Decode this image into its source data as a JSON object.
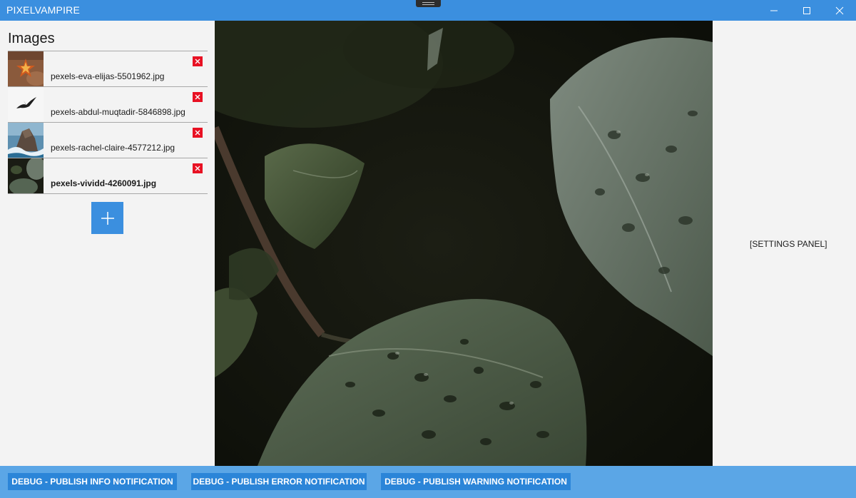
{
  "titlebar": {
    "title": "PIXELVAMPIRE"
  },
  "images_panel": {
    "heading": "Images",
    "items": [
      {
        "file_name": "pexels-eva-elijas-5501962.jpg",
        "selected": false,
        "thumb_icon": "star-ornament-thumbnail"
      },
      {
        "file_name": "pexels-abdul-muqtadir-5846898.jpg",
        "selected": false,
        "thumb_icon": "bird-thumbnail"
      },
      {
        "file_name": "pexels-rachel-claire-4577212.jpg",
        "selected": false,
        "thumb_icon": "rock-sea-thumbnail"
      },
      {
        "file_name": "pexels-vividd-4260091.jpg",
        "selected": true,
        "thumb_icon": "leaves-thumbnail"
      }
    ],
    "remove_icon": "close-icon",
    "add_icon": "plus-icon"
  },
  "settings_panel": {
    "label": "[SETTINGS PANEL]"
  },
  "debug_bar": {
    "info_label": "DEBUG - PUBLISH INFO NOTIFICATION",
    "error_label": "DEBUG - PUBLISH ERROR NOTIFICATION",
    "warning_label": "DEBUG - PUBLISH WARNING NOTIFICATION"
  },
  "colors": {
    "accent": "#3b8fdf",
    "bottom_bar": "#5ba6e6",
    "debug_button": "#2b85d8",
    "remove_button": "#e81123",
    "panel_background": "#f3f3f3"
  }
}
